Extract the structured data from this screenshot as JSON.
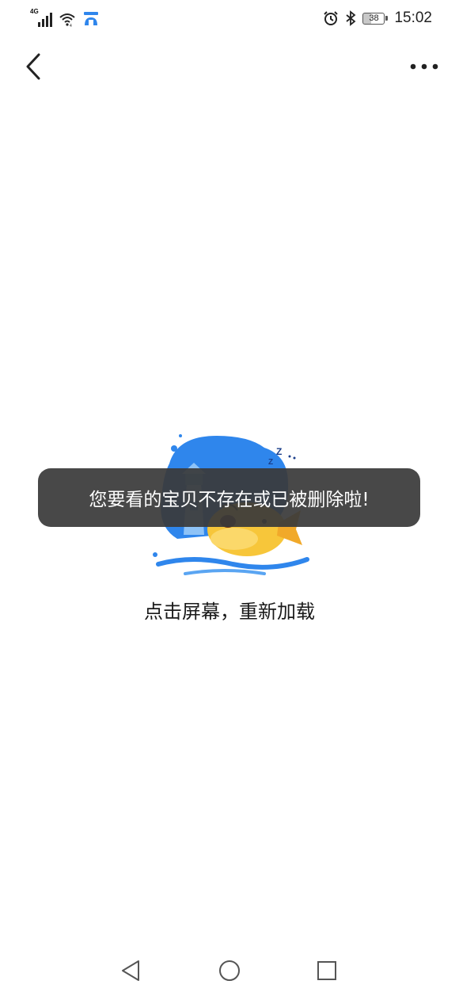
{
  "status_bar": {
    "network_type": "4G",
    "battery_level": "38",
    "time": "15:02"
  },
  "toast": {
    "message": "您要看的宝贝不存在或已被删除啦!"
  },
  "main": {
    "reload_hint": "点击屏幕，重新加载"
  },
  "icons": {
    "back": "chevron-left-icon",
    "more": "more-horizontal-icon",
    "alarm": "alarm-clock-icon",
    "bluetooth": "bluetooth-icon",
    "wifi": "wifi-icon",
    "signal": "cellular-signal-icon",
    "nav_back": "triangle-back-icon",
    "nav_home": "circle-home-icon",
    "nav_recent": "square-recents-icon"
  },
  "colors": {
    "toast_bg": "#3a3a3a",
    "illustration_blue": "#2f86ec",
    "illustration_yellow": "#f7c63a"
  }
}
